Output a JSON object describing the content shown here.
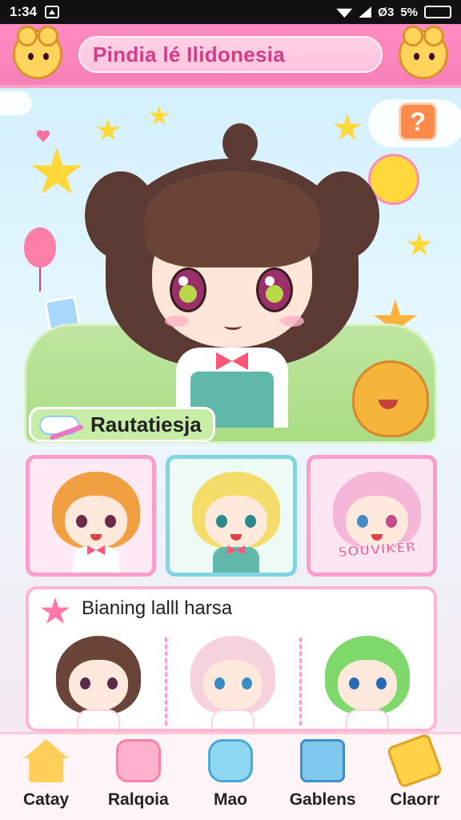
{
  "status_bar": {
    "time": "1:34",
    "right_text": "Ø3",
    "battery": "5%"
  },
  "header": {
    "title": "Pindia lé Ilidonesia"
  },
  "hero": {
    "label": "Rautatiesja",
    "help_symbol": "?"
  },
  "cards": [
    {
      "name": "orange-hair-character",
      "hair": "#f0a040",
      "sticker": ""
    },
    {
      "name": "blonde-hair-character",
      "hair": "#f4dc6a",
      "sticker": ""
    },
    {
      "name": "pink-hair-character",
      "hair": "#f6b6d8",
      "sticker": "SOUVIKER"
    }
  ],
  "panel": {
    "title": "Bianing lalll harsa",
    "items": [
      {
        "hair": "#6a4438"
      },
      {
        "hair": "#f6d2dc"
      },
      {
        "hair": "#7ed86a"
      }
    ]
  },
  "nav": {
    "items": [
      {
        "label": "Catay",
        "icon": "house-icon"
      },
      {
        "label": "Ralqoia",
        "icon": "jar-icon"
      },
      {
        "label": "Mao",
        "icon": "chat-icon"
      },
      {
        "label": "Gablens",
        "icon": "box-icon"
      },
      {
        "label": "Claorr",
        "icon": "ticket-icon"
      }
    ]
  },
  "colors": {
    "header_pink": "#f77fb8",
    "accent_orange": "#ff8a4a",
    "nav_bg": "#fff4f8"
  }
}
